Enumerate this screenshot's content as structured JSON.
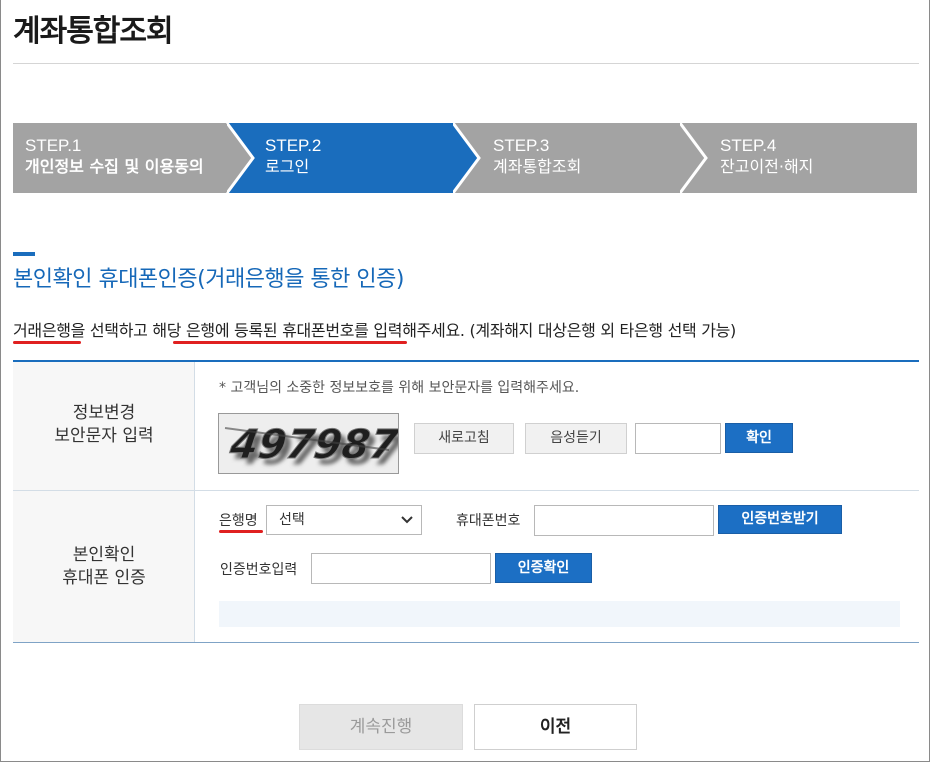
{
  "page": {
    "title": "계좌통합조회"
  },
  "steps": [
    {
      "num": "STEP.1",
      "name": "개인정보 수집 및 이용동의",
      "color": "#a3a3a3",
      "active": false
    },
    {
      "num": "STEP.2",
      "name": "로그인",
      "color": "#1a6dbd",
      "active": true
    },
    {
      "num": "STEP.3",
      "name": "계좌통합조회",
      "color": "#a3a3a3",
      "active": false
    },
    {
      "num": "STEP.4",
      "name": "잔고이전·해지",
      "color": "#a3a3a3",
      "active": false
    }
  ],
  "section": {
    "title": "본인확인 휴대폰인증(거래은행을 통한 인증)",
    "instruction": "거래은행을 선택하고 해당 은행에 등록된 휴대폰번호를 입력해주세요. (계좌해지 대상은행 외 타은행 선택 가능)"
  },
  "security_row": {
    "label_line1": "정보변경",
    "label_line2": "보안문자 입력",
    "notice": "* 고객님의 소중한 정보보호를 위해 보안문자를 입력해주세요.",
    "captcha_text": "497987",
    "refresh_label": "새로고침",
    "audio_label": "음성듣기",
    "code_value": "",
    "confirm_label": "확인"
  },
  "auth_row": {
    "label_line1": "본인확인",
    "label_line2": "휴대폰 인증",
    "bank_label": "은행명",
    "bank_selected": "선택",
    "phone_label": "휴대폰번호",
    "phone_value": "",
    "request_label": "인증번호받기",
    "code_label": "인증번호입력",
    "code_value": "",
    "verify_label": "인증확인"
  },
  "buttons": {
    "continue_label": "계속진행",
    "prev_label": "이전"
  },
  "colors": {
    "accent": "#1a6dbd",
    "underline": "#e02020"
  },
  "icons": {
    "select_chevron": "chevron-down-icon"
  }
}
